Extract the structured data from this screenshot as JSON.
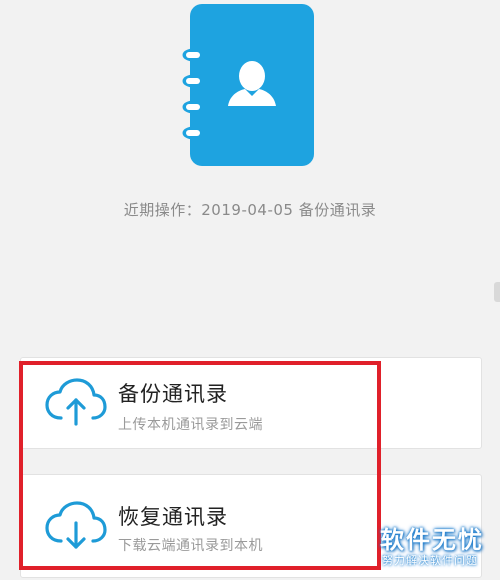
{
  "colors": {
    "book_blue": "#1ea3e0",
    "cloud_blue": "#1e9bd7",
    "highlight_red": "#e0202a",
    "background": "#f2f2f2"
  },
  "header": {
    "icon": "contact-book-icon",
    "recent_operation": "近期操作：2019-04-05 备份通讯录"
  },
  "actions": [
    {
      "icon": "cloud-upload-icon",
      "title": "备份通讯录",
      "subtitle": "上传本机通讯录到云端"
    },
    {
      "icon": "cloud-download-icon",
      "title": "恢复通讯录",
      "subtitle": "下载云端通讯录到本机"
    }
  ],
  "watermark": {
    "title": "软件无忧",
    "subtitle": "努力解决软件问题"
  }
}
